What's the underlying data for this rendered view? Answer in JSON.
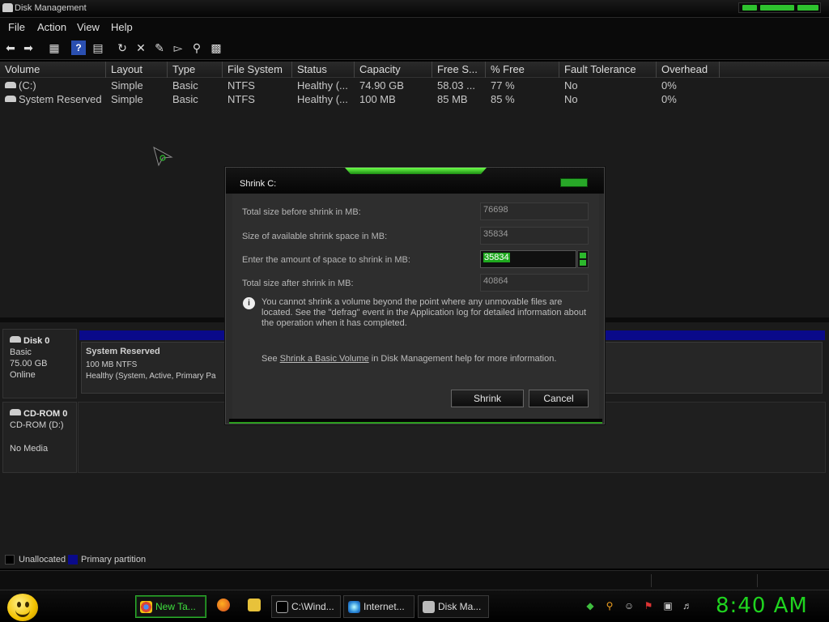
{
  "window": {
    "title": "Disk Management"
  },
  "menu": [
    "File",
    "Action",
    "View",
    "Help"
  ],
  "toolbar_icons": [
    "back-icon",
    "forward-icon",
    "properties-icon",
    "help-icon",
    "view-icon",
    "refresh-icon",
    "delete-icon",
    "edit-icon",
    "open-icon",
    "search-icon",
    "settings-icon"
  ],
  "volumes": {
    "columns": [
      "Volume",
      "Layout",
      "Type",
      "File System",
      "Status",
      "Capacity",
      "Free S...",
      "% Free",
      "Fault Tolerance",
      "Overhead"
    ],
    "rows": [
      [
        "(C:)",
        "Simple",
        "Basic",
        "NTFS",
        "Healthy (...",
        "74.90 GB",
        "58.03 ...",
        "77 %",
        "No",
        "0%"
      ],
      [
        "System Reserved",
        "Simple",
        "Basic",
        "NTFS",
        "Healthy (...",
        "100 MB",
        "85 MB",
        "85 %",
        "No",
        "0%"
      ]
    ]
  },
  "disks": [
    {
      "name": "Disk 0",
      "lines": [
        "Basic",
        "75.00 GB",
        "Online"
      ]
    },
    {
      "name": "CD-ROM 0",
      "lines": [
        "CD-ROM (D:)",
        "",
        "No Media"
      ]
    }
  ],
  "partition": {
    "name": "System Reserved",
    "size": "100 MB NTFS",
    "status": "Healthy (System, Active, Primary Pa"
  },
  "legend": {
    "unallocated": "Unallocated",
    "primary": "Primary partition",
    "unallocated_color": "#000000",
    "primary_color": "#0a0a8a"
  },
  "dialog": {
    "title": "Shrink C:",
    "fields": [
      {
        "label": "Total size before shrink in MB:",
        "value": "76698"
      },
      {
        "label": "Size of available shrink space in MB:",
        "value": "35834"
      },
      {
        "label": "Enter the amount of space to shrink in MB:",
        "value": "35834"
      },
      {
        "label": "Total size after shrink in MB:",
        "value": "40864"
      }
    ],
    "info": "You cannot shrink a volume beyond the point where any unmovable files are located. See the \"defrag\" event in the Application log for detailed information about the operation when it has completed.",
    "help_prefix": "See ",
    "help_link": "Shrink a Basic Volume",
    "help_suffix": " in Disk Management help for more information.",
    "shrink_label": "Shrink",
    "cancel_label": "Cancel"
  },
  "taskbar": {
    "tasks": [
      "New Ta...",
      "C:\\Wind...",
      "Internet...",
      "Disk Ma..."
    ],
    "clock": "8:40 AM",
    "accent": "#1fd41f"
  }
}
